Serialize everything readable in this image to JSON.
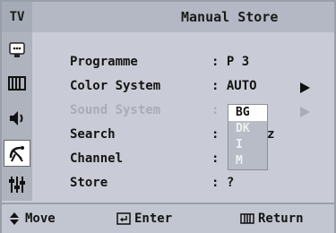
{
  "header": {
    "source_label": "TV",
    "title": "Manual Store"
  },
  "sidebar": {
    "icons": [
      {
        "name": "input-icon"
      },
      {
        "name": "picture-icon"
      },
      {
        "name": "sound-icon"
      },
      {
        "name": "channel-icon",
        "active": true
      },
      {
        "name": "setup-icon"
      }
    ]
  },
  "menu": {
    "items": [
      {
        "label": "Programme",
        "value": ": P 3"
      },
      {
        "label": "Color System",
        "value": ": AUTO"
      },
      {
        "label": "Sound System",
        "value": ":"
      },
      {
        "label": "Search",
        "value": ":",
        "partial_value": "z"
      },
      {
        "label": "Channel",
        "value": ":"
      },
      {
        "label": "Store",
        "value": ": ?"
      }
    ]
  },
  "dropdown": {
    "options": [
      "BG",
      "DK",
      "I",
      "M"
    ],
    "selected": "BG"
  },
  "footer": {
    "move_label": "Move",
    "enter_label": "Enter",
    "return_label": "Return"
  }
}
